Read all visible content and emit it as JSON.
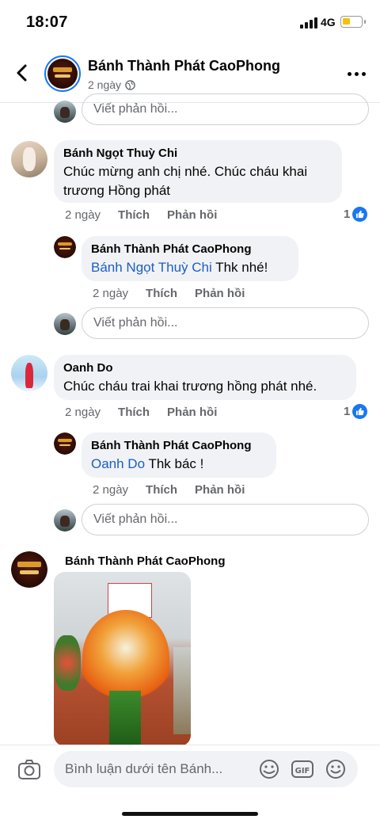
{
  "status_bar": {
    "time": "18:07",
    "network": "4G"
  },
  "post_header": {
    "author": "Bánh Thành Phát CaoPhong",
    "time": "2 ngày"
  },
  "reply_placeholder": "Viết phản hồi...",
  "actions": {
    "like": "Thích",
    "reply": "Phản hồi"
  },
  "comments": [
    {
      "author": "Bánh Ngọt Thuỳ Chi",
      "text_line1": "Chúc mừng anh chị nhé. Chúc cháu khai",
      "text_line2": "trương Hồng phát",
      "time": "2 ngày",
      "like_count": "1",
      "reply": {
        "author": "Bánh Thành Phát CaoPhong",
        "mention": "Bánh Ngọt Thuỳ Chi",
        "text": " Thk nhé!",
        "time": "2 ngày"
      }
    },
    {
      "author": "Oanh Do",
      "text_line1": "Chúc cháu trai khai trương hồng phát nhé.",
      "time": "2 ngày",
      "like_count": "1",
      "reply": {
        "author": "Bánh Thành Phát CaoPhong",
        "mention": "Oanh Do",
        "text": " Thk bác !",
        "time": "2 ngày"
      }
    },
    {
      "author": "Bánh Thành Phát CaoPhong"
    }
  ],
  "composer": {
    "placeholder": "Bình luận dưới tên Bánh..."
  },
  "colors": {
    "accent": "#1877f2",
    "mention": "#1d5fc2",
    "bubble": "#f0f2f5",
    "battery": "#f4c20d"
  },
  "icons": [
    "back-arrow-icon",
    "globe-icon",
    "more-icon",
    "like-icon",
    "camera-icon",
    "sticker-icon",
    "gif-icon",
    "emoji-icon"
  ]
}
